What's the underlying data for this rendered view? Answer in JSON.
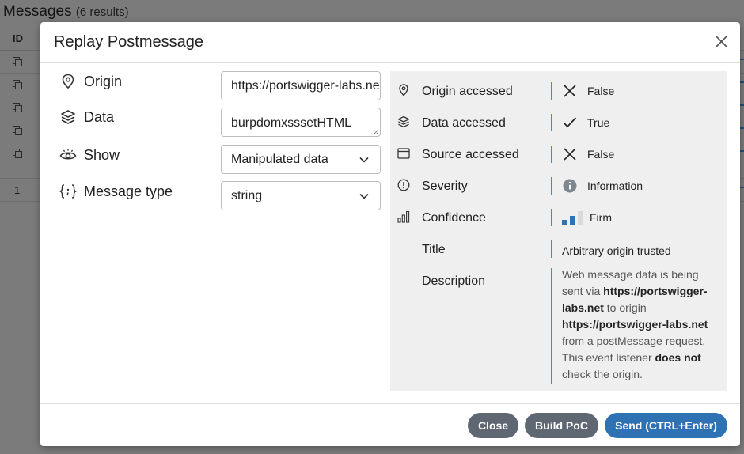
{
  "background": {
    "title": "Messages",
    "count": "(6 results)",
    "column_id": "ID",
    "row_number": "1"
  },
  "dialog": {
    "title": "Replay Postmessage",
    "close_icon": "close-icon"
  },
  "form": {
    "origin": {
      "label": "Origin",
      "icon": "map-pin-icon",
      "value": "https://portswigger-labs.net"
    },
    "data": {
      "label": "Data",
      "icon": "layers-icon",
      "value": "burpdomxsssetHTML"
    },
    "show": {
      "label": "Show",
      "icon": "eye-icon",
      "selected": "Manipulated data"
    },
    "message_type": {
      "label": "Message type",
      "icon": "code-braces-icon",
      "selected": "string"
    }
  },
  "info": {
    "origin_accessed": {
      "label": "Origin accessed",
      "value": "False",
      "value_icon": "cross-icon"
    },
    "data_accessed": {
      "label": "Data accessed",
      "value": "True",
      "value_icon": "check-icon"
    },
    "source_accessed": {
      "label": "Source accessed",
      "value": "False",
      "value_icon": "cross-icon"
    },
    "severity": {
      "label": "Severity",
      "value": "Information",
      "value_icon": "info-icon"
    },
    "confidence": {
      "label": "Confidence",
      "value": "Firm",
      "value_icon": "signal-bars-icon",
      "level": 2,
      "max_level": 3
    },
    "title": {
      "label": "Title",
      "value": "Arbitrary origin trusted"
    },
    "description": {
      "label": "Description",
      "p1": "Web message data is being sent via ",
      "b1": "https://portswigger-labs.net",
      "p2": " to origin ",
      "b2": "https://portswigger-labs.net",
      "p3": " from a postMessage request. This event listener ",
      "b3": "does not",
      "p4": " check the origin."
    }
  },
  "buttons": {
    "close": "Close",
    "build_poc": "Build PoC",
    "send": "Send (CTRL+Enter)"
  },
  "colors": {
    "accent": "#3b8dd4",
    "primary_button": "#2f72b4",
    "secondary_button": "#5f6872",
    "panel_bg": "#efefef"
  }
}
